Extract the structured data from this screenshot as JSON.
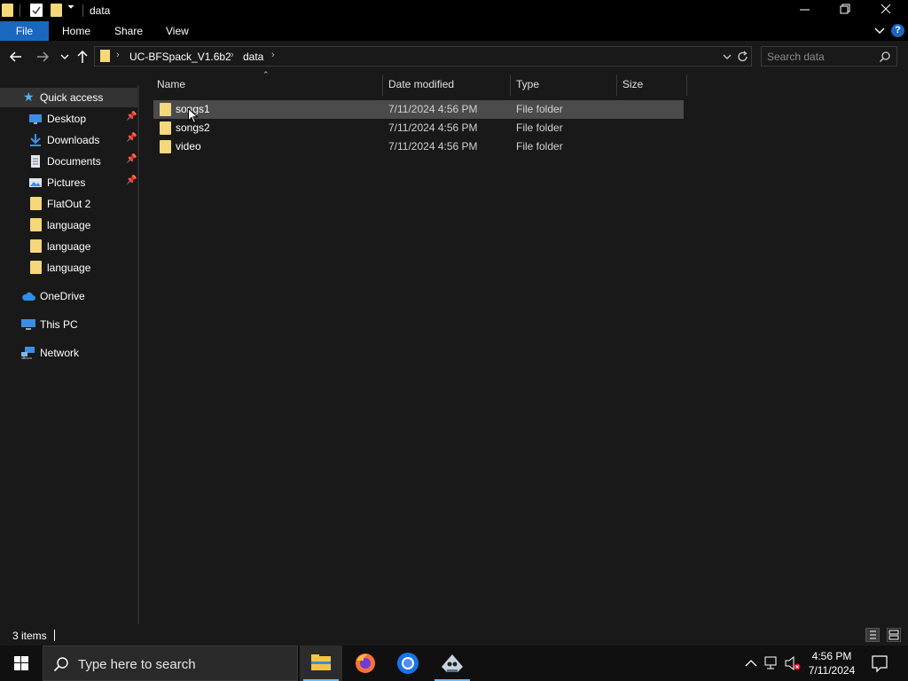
{
  "window": {
    "title": "data",
    "controls": {
      "minimize": "—",
      "maximize": "❐",
      "close": "✕"
    }
  },
  "ribbon": {
    "tabs": [
      "File",
      "Home",
      "Share",
      "View"
    ]
  },
  "address": {
    "breadcrumbs": [
      "UC-BFSpack_V1.6b2",
      "data"
    ]
  },
  "search": {
    "placeholder": "Search data"
  },
  "sidebar": {
    "quick_access_label": "Quick access",
    "pinned": [
      {
        "label": "Desktop",
        "icon": "desktop-icon",
        "pinned": true
      },
      {
        "label": "Downloads",
        "icon": "downloads-icon",
        "pinned": true
      },
      {
        "label": "Documents",
        "icon": "documents-icon",
        "pinned": true
      },
      {
        "label": "Pictures",
        "icon": "pictures-icon",
        "pinned": true
      },
      {
        "label": "FlatOut 2",
        "icon": "folder-icon",
        "pinned": false
      },
      {
        "label": "language",
        "icon": "folder-icon",
        "pinned": false
      },
      {
        "label": "language",
        "icon": "folder-icon",
        "pinned": false
      },
      {
        "label": "language",
        "icon": "folder-icon",
        "pinned": false
      }
    ],
    "onedrive": "OneDrive",
    "this_pc": "This PC",
    "network": "Network"
  },
  "columns": [
    "Name",
    "Date modified",
    "Type",
    "Size"
  ],
  "files": [
    {
      "name": "songs1",
      "date": "7/11/2024 4:56 PM",
      "type": "File folder",
      "size": "",
      "selected": true
    },
    {
      "name": "songs2",
      "date": "7/11/2024 4:56 PM",
      "type": "File folder",
      "size": "",
      "selected": false
    },
    {
      "name": "video",
      "date": "7/11/2024 4:56 PM",
      "type": "File folder",
      "size": "",
      "selected": false
    }
  ],
  "status": {
    "count": "3 items"
  },
  "taskbar": {
    "search_placeholder": "Type here to search",
    "clock_time": "4:56 PM",
    "clock_date": "7/11/2024"
  },
  "colors": {
    "folder": "#f5d87b",
    "file_tab": "#1a67c0",
    "background": "#191919",
    "selected_row": "#4b4b4b"
  }
}
